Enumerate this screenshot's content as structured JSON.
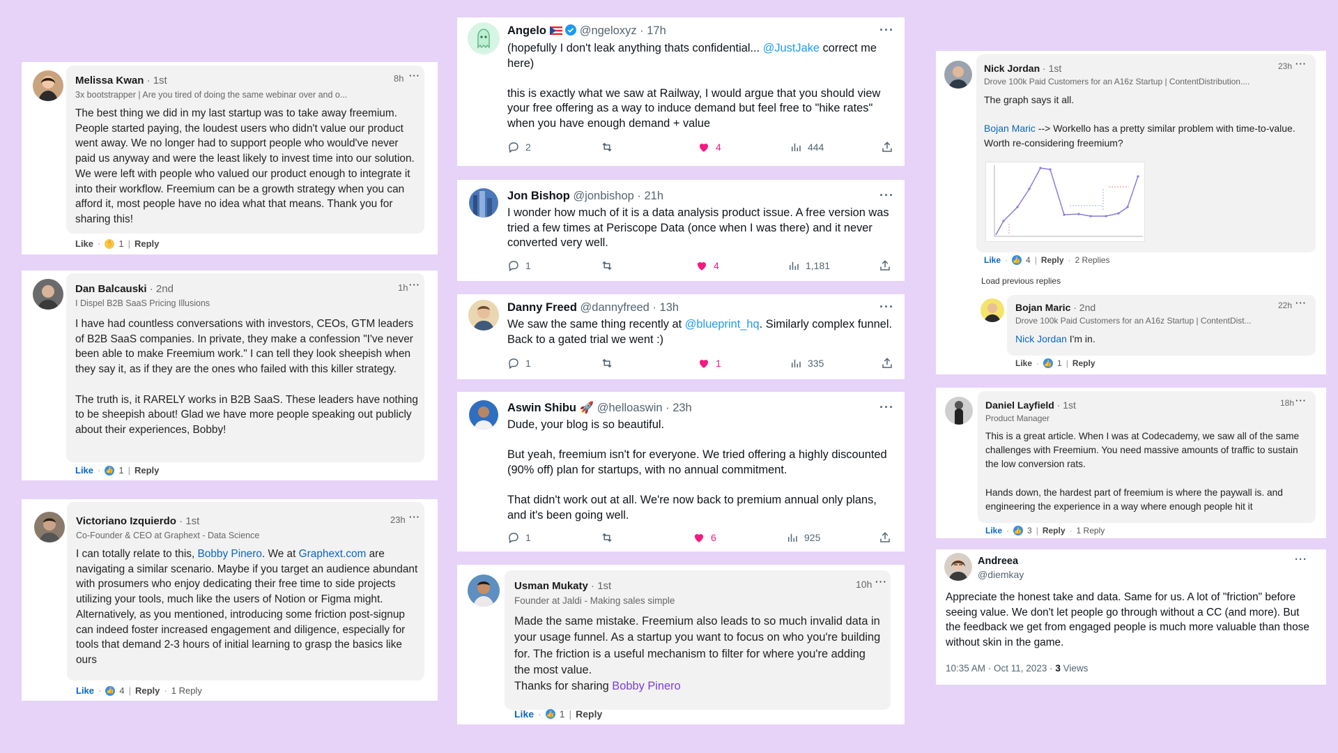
{
  "left": {
    "melissa": {
      "name": "Melissa Kwan",
      "degree": "· 1st",
      "headline": "3x bootstrapper | Are you tired of doing the same webinar over and o...",
      "time": "8h",
      "text": "The best thing we did in my last startup was to take away freemium. People started paying, the loudest users who didn't value our product went away. We no longer had to support people who would've never paid us anyway and were the least likely to invest time into our solution. We were left with people who valued our product enough to integrate it into their workflow. Freemium can be a growth strategy when you can afford it, most people have no idea what that means. Thank you for sharing this!",
      "like": "Like",
      "count": "1",
      "reply": "Reply"
    },
    "dan": {
      "name": "Dan Balcauski",
      "degree": "· 2nd",
      "headline": "I Dispel B2B SaaS Pricing Illusions",
      "time": "1h",
      "text": "I have had countless conversations with investors, CEOs, GTM leaders of B2B SaaS companies. In private, they make a confession \"I've never been able to make Freemium work.\" I can tell they look sheepish when they say it, as if they are the ones who failed with this killer strategy.\n\nThe truth is, it RARELY works in B2B SaaS. These leaders have nothing to be sheepish about! Glad we have more people speaking out publicly about their experiences, Bobby!",
      "like": "Like",
      "count": "1",
      "reply": "Reply"
    },
    "victoriano": {
      "name": "Victoriano Izquierdo",
      "degree": "· 1st",
      "headline": "Co-Founder & CEO at Graphext - Data Science",
      "time": "23h",
      "text_a": "I can totally relate to this, ",
      "mention": "Bobby Pinero",
      "text_b": ". We at ",
      "link": "Graphext.com",
      "text_c": " are navigating a similar scenario. Maybe if you target an audience abundant with prosumers who enjoy dedicating their free time to side projects utilizing your tools, much like the users of Notion or Figma might. Alternatively, as you mentioned, introducing some friction post-signup can indeed foster increased engagement and diligence, especially for tools that demand 2-3 hours of initial learning to grasp the basics like ours",
      "like": "Like",
      "count": "4",
      "reply": "Reply",
      "replies": "1 Reply"
    }
  },
  "middle": {
    "angelo": {
      "name": "Angelo",
      "handle": "@ngeloxyz · 17h",
      "text_a": "(hopefully I don't leak anything thats confidential... ",
      "mention": "@JustJake",
      "text_b": " correct me here)\n\nthis is exactly what we saw at Railway, I would argue that you should view your free offering as a way to induce demand but feel free to \"hike rates\" when you have enough demand + value",
      "replies": "2",
      "likes": "4",
      "views": "444"
    },
    "jon": {
      "name": "Jon Bishop",
      "handle": "@jonbishop · 21h",
      "text": "I wonder how much of it is a data analysis product issue. A free version was tried a few times at Periscope Data (once when I was there) and it never converted very well.",
      "replies": "1",
      "likes": "4",
      "views": "1,181"
    },
    "danny": {
      "name": "Danny Freed",
      "handle": "@dannyfreed · 13h",
      "text_a": "We saw the same thing recently at ",
      "mention": "@blueprint_hq",
      "text_b": ". Similarly complex funnel. Back to a gated trial we went :)",
      "replies": "1",
      "likes": "1",
      "views": "335"
    },
    "aswin": {
      "name": "Aswin Shibu 🚀",
      "handle": "@helloaswin · 23h",
      "text": "Dude, your blog is so beautiful.\n\nBut yeah, freemium isn't for everyone. We tried offering a highly discounted (90% off) plan for startups, with no annual commitment.\n\nThat didn't work out at all. We're now back to premium annual only plans, and it's been going well.",
      "replies": "1",
      "likes": "6",
      "views": "925"
    },
    "usman": {
      "name": "Usman Mukaty",
      "degree": "· 1st",
      "headline": "Founder at Jaldi - Making sales simple",
      "time": "10h",
      "text": "Made the same mistake. Freemium also leads to so much invalid data in your usage funnel. As a startup you want to focus on who you're building for. The friction is a useful mechanism to filter for where you're adding the most value.",
      "thanks": "Thanks for sharing ",
      "mention": "Bobby Pinero",
      "like": "Like",
      "count": "1",
      "reply": "Reply"
    }
  },
  "right": {
    "nick": {
      "name": "Nick Jordan",
      "degree": "· 1st",
      "headline": "Drove 100k Paid Customers for an A16z Startup | ContentDistribution....",
      "time": "23h",
      "text": "The graph says it all.",
      "mention": "Bojan Maric",
      "text_b": " --> Workello has a pretty similar problem with time-to-value. Worth re-considering freemium?",
      "like": "Like",
      "count": "4",
      "reply": "Reply",
      "replies": "2 Replies",
      "load_previous": "Load previous replies"
    },
    "bojan": {
      "name": "Bojan Maric",
      "degree": "· 2nd",
      "headline": "Drove 100k Paid Customers for an A16z Startup | ContentDist...",
      "time": "22h",
      "mention": "Nick Jordan",
      "text": " I'm in.",
      "like": "Like",
      "count": "1",
      "reply": "Reply"
    },
    "daniel": {
      "name": "Daniel Layfield",
      "degree": "· 1st",
      "headline": "Product Manager",
      "time": "18h",
      "text": "This is a great article. When I was at Codecademy, we saw all of the same challenges with Freemium. You need massive amounts of traffic to sustain the low conversion rats.\n\nHands down, the hardest part of freemium is where the paywall is. and engineering the experience in a way where enough people hit it",
      "like": "Like",
      "count": "3",
      "reply": "Reply",
      "replies": "1 Reply"
    },
    "andreea": {
      "name": "Andreea",
      "handle": "@diemkay",
      "text": "Appreciate the honest take and data. Same for us. A lot of \"friction\" before seeing value. We don't let people go through without a CC (and more). But the feedback we get from engaged people is much more valuable than those without skin in the game.",
      "timestamp": "10:35 AM · Oct 11, 2023 · ",
      "views_count": "3",
      "views_label": " Views"
    }
  },
  "colors": {
    "background": "#e6d3f7",
    "linkedin_blue": "#0a66c2",
    "twitter_blue": "#1d9bf0",
    "heart_pink": "#f91880"
  }
}
